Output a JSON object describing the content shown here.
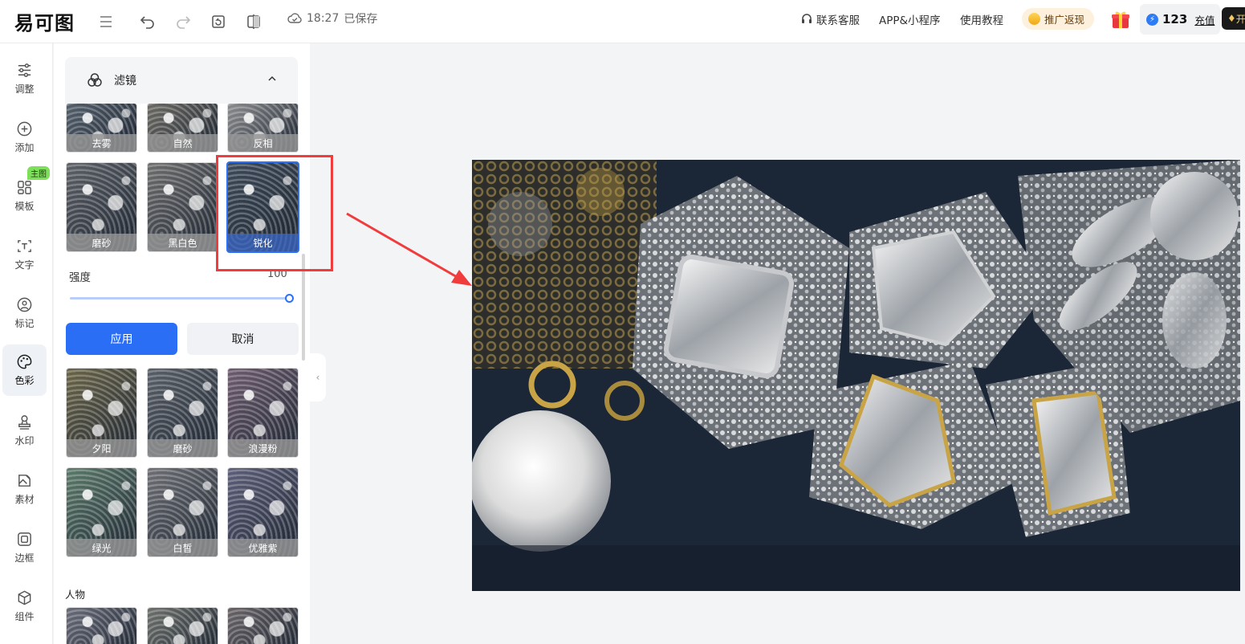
{
  "app": {
    "logo_text": "易可图",
    "save_time": "18:27",
    "save_status": "已保存"
  },
  "header_links": {
    "support": "联系客服",
    "app": "APP&小程序",
    "tutorial": "使用教程",
    "promo": "推广返现",
    "credits": "123",
    "recharge": "充值",
    "vip": "开"
  },
  "rail": {
    "items": [
      {
        "label": "调整",
        "icon": "sliders-icon"
      },
      {
        "label": "添加",
        "icon": "plus-circle-icon"
      },
      {
        "label": "模板",
        "icon": "grid-icon"
      },
      {
        "label": "文字",
        "icon": "text-icon"
      },
      {
        "label": "标记",
        "icon": "marker-icon"
      },
      {
        "label": "色彩",
        "icon": "palette-icon"
      },
      {
        "label": "水印",
        "icon": "stamp-icon"
      },
      {
        "label": "素材",
        "icon": "material-icon"
      },
      {
        "label": "边框",
        "icon": "frame-icon"
      },
      {
        "label": "组件",
        "icon": "cube-icon"
      }
    ],
    "badge": "主图"
  },
  "panel": {
    "section_title": "滤镜",
    "filters_top": [
      {
        "label": "去雾",
        "tone": "#54606c"
      },
      {
        "label": "自然",
        "tone": "#6c6a63"
      },
      {
        "label": "反相",
        "tone": "#8b8c8e"
      }
    ],
    "filters_mid": [
      {
        "label": "磨砂",
        "tone": "#5c6066"
      },
      {
        "label": "黑白色",
        "tone": "#6d6d6d"
      },
      {
        "label": "锐化",
        "tone": "#3d4a59",
        "selected": true
      }
    ],
    "strength_label": "强度",
    "strength_value": "100",
    "apply_label": "应用",
    "cancel_label": "取消",
    "filters_bottom1": [
      {
        "label": "夕阳",
        "tone": "#6b6548"
      },
      {
        "label": "磨砂",
        "tone": "#5a6068"
      },
      {
        "label": "浪漫粉",
        "tone": "#6e5c70"
      }
    ],
    "filters_bottom2": [
      {
        "label": "绿光",
        "tone": "#5b7a6a"
      },
      {
        "label": "白皙",
        "tone": "#6d6f74"
      },
      {
        "label": "优雅紫",
        "tone": "#5e5f7a"
      }
    ],
    "people_title": "人物",
    "people_filters": [
      {
        "tone": "#6a6c7a"
      },
      {
        "tone": "#6e716c"
      },
      {
        "tone": "#6a6468"
      }
    ]
  }
}
